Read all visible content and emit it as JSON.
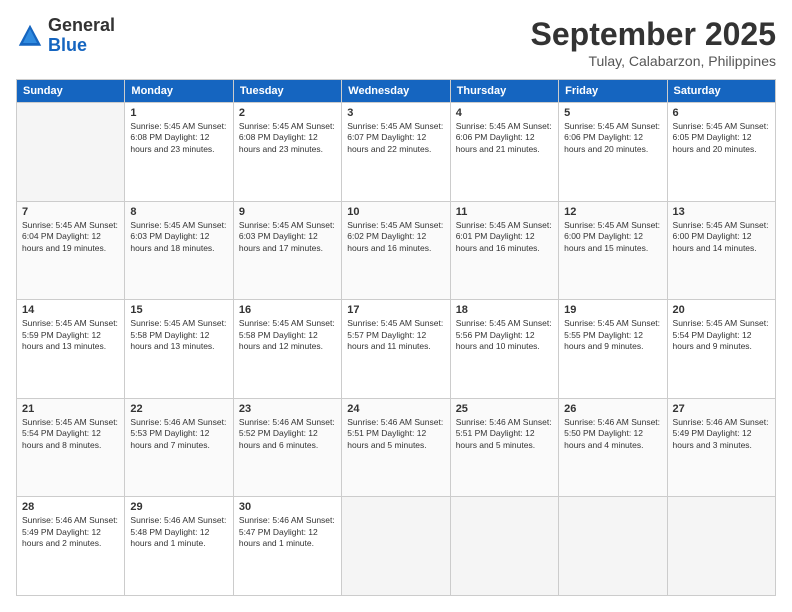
{
  "logo": {
    "line1": "General",
    "line2": "Blue"
  },
  "title": "September 2025",
  "subtitle": "Tulay, Calabarzon, Philippines",
  "weekdays": [
    "Sunday",
    "Monday",
    "Tuesday",
    "Wednesday",
    "Thursday",
    "Friday",
    "Saturday"
  ],
  "weeks": [
    [
      {
        "day": "",
        "info": ""
      },
      {
        "day": "1",
        "info": "Sunrise: 5:45 AM\nSunset: 6:08 PM\nDaylight: 12 hours\nand 23 minutes."
      },
      {
        "day": "2",
        "info": "Sunrise: 5:45 AM\nSunset: 6:08 PM\nDaylight: 12 hours\nand 23 minutes."
      },
      {
        "day": "3",
        "info": "Sunrise: 5:45 AM\nSunset: 6:07 PM\nDaylight: 12 hours\nand 22 minutes."
      },
      {
        "day": "4",
        "info": "Sunrise: 5:45 AM\nSunset: 6:06 PM\nDaylight: 12 hours\nand 21 minutes."
      },
      {
        "day": "5",
        "info": "Sunrise: 5:45 AM\nSunset: 6:06 PM\nDaylight: 12 hours\nand 20 minutes."
      },
      {
        "day": "6",
        "info": "Sunrise: 5:45 AM\nSunset: 6:05 PM\nDaylight: 12 hours\nand 20 minutes."
      }
    ],
    [
      {
        "day": "7",
        "info": "Sunrise: 5:45 AM\nSunset: 6:04 PM\nDaylight: 12 hours\nand 19 minutes."
      },
      {
        "day": "8",
        "info": "Sunrise: 5:45 AM\nSunset: 6:03 PM\nDaylight: 12 hours\nand 18 minutes."
      },
      {
        "day": "9",
        "info": "Sunrise: 5:45 AM\nSunset: 6:03 PM\nDaylight: 12 hours\nand 17 minutes."
      },
      {
        "day": "10",
        "info": "Sunrise: 5:45 AM\nSunset: 6:02 PM\nDaylight: 12 hours\nand 16 minutes."
      },
      {
        "day": "11",
        "info": "Sunrise: 5:45 AM\nSunset: 6:01 PM\nDaylight: 12 hours\nand 16 minutes."
      },
      {
        "day": "12",
        "info": "Sunrise: 5:45 AM\nSunset: 6:00 PM\nDaylight: 12 hours\nand 15 minutes."
      },
      {
        "day": "13",
        "info": "Sunrise: 5:45 AM\nSunset: 6:00 PM\nDaylight: 12 hours\nand 14 minutes."
      }
    ],
    [
      {
        "day": "14",
        "info": "Sunrise: 5:45 AM\nSunset: 5:59 PM\nDaylight: 12 hours\nand 13 minutes."
      },
      {
        "day": "15",
        "info": "Sunrise: 5:45 AM\nSunset: 5:58 PM\nDaylight: 12 hours\nand 13 minutes."
      },
      {
        "day": "16",
        "info": "Sunrise: 5:45 AM\nSunset: 5:58 PM\nDaylight: 12 hours\nand 12 minutes."
      },
      {
        "day": "17",
        "info": "Sunrise: 5:45 AM\nSunset: 5:57 PM\nDaylight: 12 hours\nand 11 minutes."
      },
      {
        "day": "18",
        "info": "Sunrise: 5:45 AM\nSunset: 5:56 PM\nDaylight: 12 hours\nand 10 minutes."
      },
      {
        "day": "19",
        "info": "Sunrise: 5:45 AM\nSunset: 5:55 PM\nDaylight: 12 hours\nand 9 minutes."
      },
      {
        "day": "20",
        "info": "Sunrise: 5:45 AM\nSunset: 5:54 PM\nDaylight: 12 hours\nand 9 minutes."
      }
    ],
    [
      {
        "day": "21",
        "info": "Sunrise: 5:45 AM\nSunset: 5:54 PM\nDaylight: 12 hours\nand 8 minutes."
      },
      {
        "day": "22",
        "info": "Sunrise: 5:46 AM\nSunset: 5:53 PM\nDaylight: 12 hours\nand 7 minutes."
      },
      {
        "day": "23",
        "info": "Sunrise: 5:46 AM\nSunset: 5:52 PM\nDaylight: 12 hours\nand 6 minutes."
      },
      {
        "day": "24",
        "info": "Sunrise: 5:46 AM\nSunset: 5:51 PM\nDaylight: 12 hours\nand 5 minutes."
      },
      {
        "day": "25",
        "info": "Sunrise: 5:46 AM\nSunset: 5:51 PM\nDaylight: 12 hours\nand 5 minutes."
      },
      {
        "day": "26",
        "info": "Sunrise: 5:46 AM\nSunset: 5:50 PM\nDaylight: 12 hours\nand 4 minutes."
      },
      {
        "day": "27",
        "info": "Sunrise: 5:46 AM\nSunset: 5:49 PM\nDaylight: 12 hours\nand 3 minutes."
      }
    ],
    [
      {
        "day": "28",
        "info": "Sunrise: 5:46 AM\nSunset: 5:49 PM\nDaylight: 12 hours\nand 2 minutes."
      },
      {
        "day": "29",
        "info": "Sunrise: 5:46 AM\nSunset: 5:48 PM\nDaylight: 12 hours\nand 1 minute."
      },
      {
        "day": "30",
        "info": "Sunrise: 5:46 AM\nSunset: 5:47 PM\nDaylight: 12 hours\nand 1 minute."
      },
      {
        "day": "",
        "info": ""
      },
      {
        "day": "",
        "info": ""
      },
      {
        "day": "",
        "info": ""
      },
      {
        "day": "",
        "info": ""
      }
    ]
  ]
}
